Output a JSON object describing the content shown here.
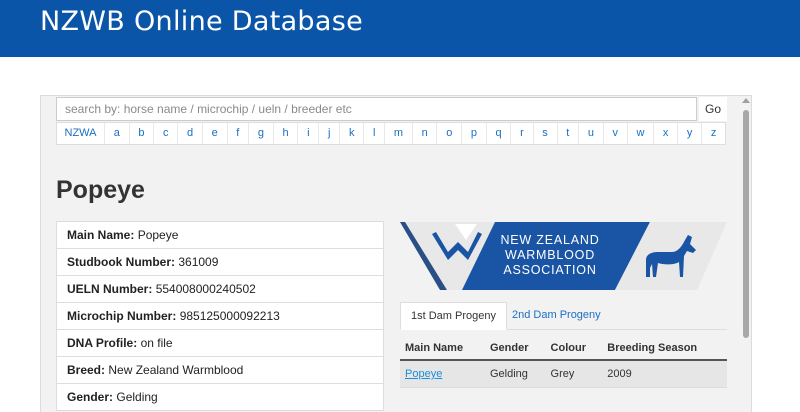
{
  "header": {
    "title": "NZWB Online Database"
  },
  "search": {
    "placeholder": "search by: horse name / microchip / ueln / breeder etc",
    "go_label": "Go"
  },
  "letters": [
    "NZWA",
    "a",
    "b",
    "c",
    "d",
    "e",
    "f",
    "g",
    "h",
    "i",
    "j",
    "k",
    "l",
    "m",
    "n",
    "o",
    "p",
    "q",
    "r",
    "s",
    "t",
    "u",
    "v",
    "w",
    "x",
    "y",
    "z"
  ],
  "horse": {
    "name": "Popeye",
    "fields": [
      {
        "label": "Main Name:",
        "value": "Popeye"
      },
      {
        "label": "Studbook Number:",
        "value": "361009"
      },
      {
        "label": "UELN Number:",
        "value": "554008000240502"
      },
      {
        "label": "Microchip Number:",
        "value": "985125000092213"
      },
      {
        "label": "DNA Profile:",
        "value": "on file"
      },
      {
        "label": "Breed:",
        "value": "New Zealand Warmblood"
      },
      {
        "label": "Gender:",
        "value": "Gelding"
      }
    ]
  },
  "logo": {
    "line1": "NEW ZEALAND",
    "line2": "WARMBLOOD",
    "line3": "ASSOCIATION",
    "brand_blue": "#1a55a5",
    "light_grey": "#e8e8e8"
  },
  "tabs": [
    {
      "label": "1st Dam Progeny",
      "active": true
    },
    {
      "label": "2nd Dam Progeny",
      "active": false
    }
  ],
  "progeny": {
    "columns": [
      "Main Name",
      "Gender",
      "Colour",
      "Breeding Season"
    ],
    "rows": [
      {
        "main_name": "Popeye",
        "gender": "Gelding",
        "colour": "Grey",
        "breeding_season": "2009"
      }
    ]
  },
  "colors": {
    "header_blue": "#0b55a8",
    "link_blue": "#1a6fc4"
  }
}
